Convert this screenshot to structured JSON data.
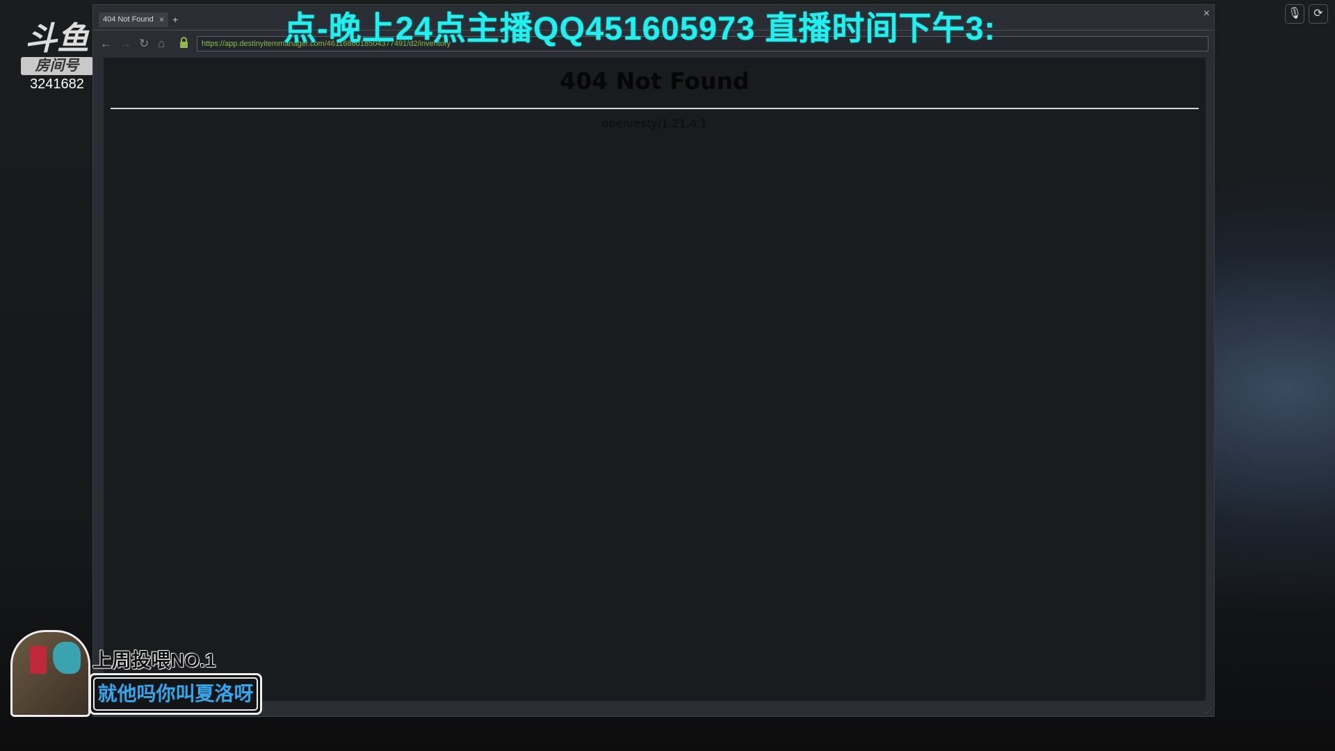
{
  "browser": {
    "tab_title": "404 Not Found",
    "tab_close": "×",
    "new_tab": "+",
    "close_window": "×",
    "url": "https://app.destinyitemmanager.com/4611686018504377491/d2/inventory",
    "nav": {
      "back": "←",
      "forward": "→",
      "reload": "↻",
      "home": "⌂"
    }
  },
  "page": {
    "heading": "404 Not Found",
    "server": "openresty/1.21.4.1"
  },
  "overlay": {
    "ticker": "点-晚上24点主播QQ451605973  直播时间下午3:",
    "logo": {
      "brand": "斗鱼",
      "room_label": "房间号",
      "room_number": "3241682"
    },
    "banner": {
      "title": "上周投喂NO.1",
      "name": "就他吗你叫夏洛呀"
    },
    "right_icons": [
      "microphone-icon",
      "refresh-icon"
    ],
    "ticker_color": "#22f0ee"
  }
}
